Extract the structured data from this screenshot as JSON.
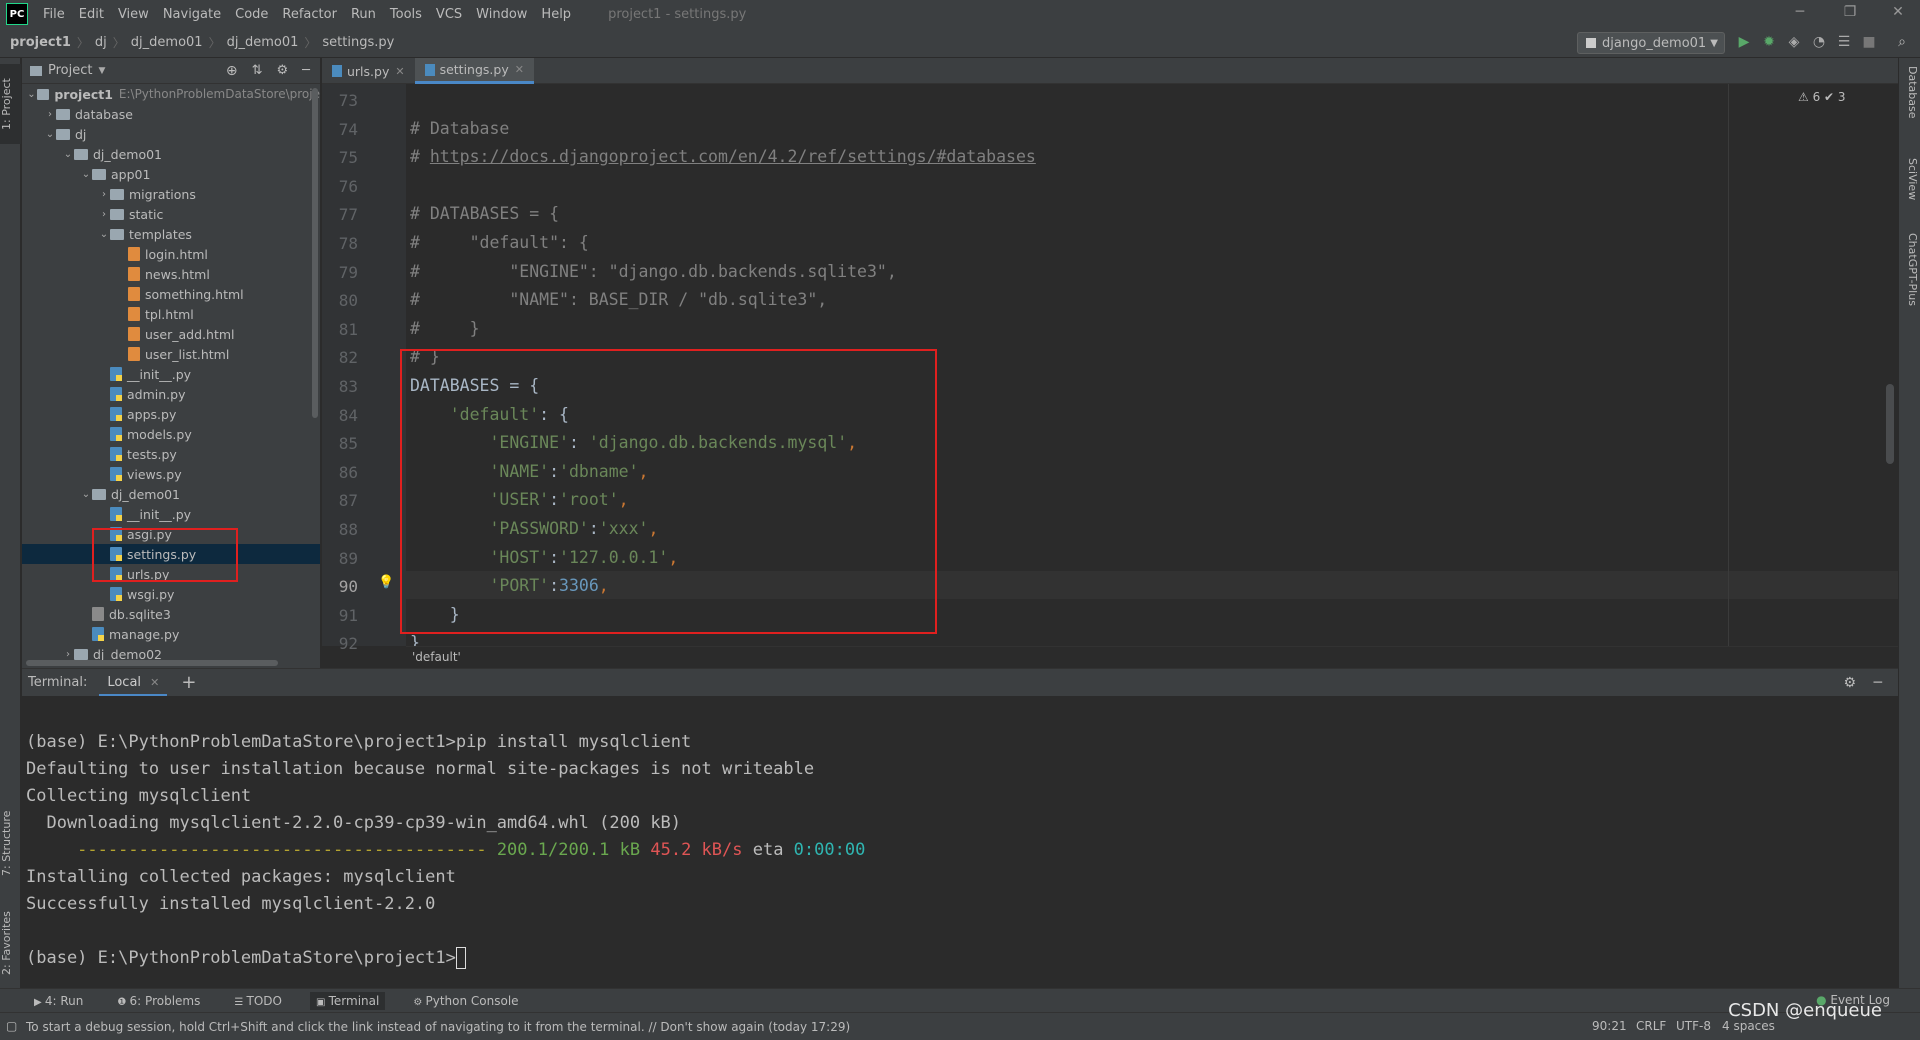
{
  "app": {
    "logo": "PC",
    "window_title": "project1 - settings.py",
    "menu": [
      "File",
      "Edit",
      "View",
      "Navigate",
      "Code",
      "Refactor",
      "Run",
      "Tools",
      "VCS",
      "Window",
      "Help"
    ]
  },
  "breadcrumbs": [
    "project1",
    "dj",
    "dj_demo01",
    "dj_demo01",
    "settings.py"
  ],
  "run_config": "django_demo01",
  "left_strip": {
    "project_tab": "1: Project",
    "structure_tab": "7: Structure",
    "favorites_tab": "2: Favorites"
  },
  "right_strip": [
    "Database",
    "SciView",
    "ChatGPT-Plus"
  ],
  "project_panel": {
    "title": "Project",
    "tree": [
      {
        "label": "project1",
        "path": "E:\\PythonProblemDataStore\\proje",
        "kind": "folder",
        "depth": 0,
        "open": true,
        "bold": true
      },
      {
        "label": "database",
        "kind": "folder",
        "depth": 1,
        "open": false
      },
      {
        "label": "dj",
        "kind": "folder",
        "depth": 1,
        "open": true
      },
      {
        "label": "dj_demo01",
        "kind": "folder",
        "depth": 2,
        "open": true
      },
      {
        "label": "app01",
        "kind": "folder",
        "depth": 3,
        "open": true
      },
      {
        "label": "migrations",
        "kind": "folder",
        "depth": 4,
        "open": false
      },
      {
        "label": "static",
        "kind": "folder",
        "depth": 4,
        "open": false
      },
      {
        "label": "templates",
        "kind": "folder",
        "depth": 4,
        "open": true
      },
      {
        "label": "login.html",
        "kind": "html",
        "depth": 5
      },
      {
        "label": "news.html",
        "kind": "html",
        "depth": 5
      },
      {
        "label": "something.html",
        "kind": "html",
        "depth": 5
      },
      {
        "label": "tpl.html",
        "kind": "html",
        "depth": 5
      },
      {
        "label": "user_add.html",
        "kind": "html",
        "depth": 5
      },
      {
        "label": "user_list.html",
        "kind": "html",
        "depth": 5
      },
      {
        "label": "__init__.py",
        "kind": "py",
        "depth": 4
      },
      {
        "label": "admin.py",
        "kind": "py",
        "depth": 4
      },
      {
        "label": "apps.py",
        "kind": "py",
        "depth": 4
      },
      {
        "label": "models.py",
        "kind": "py",
        "depth": 4
      },
      {
        "label": "tests.py",
        "kind": "py",
        "depth": 4
      },
      {
        "label": "views.py",
        "kind": "py",
        "depth": 4
      },
      {
        "label": "dj_demo01",
        "kind": "folder",
        "depth": 3,
        "open": true
      },
      {
        "label": "__init__.py",
        "kind": "py",
        "depth": 4
      },
      {
        "label": "asgi.py",
        "kind": "py",
        "depth": 4
      },
      {
        "label": "settings.py",
        "kind": "py",
        "depth": 4,
        "selected": true
      },
      {
        "label": "urls.py",
        "kind": "py",
        "depth": 4
      },
      {
        "label": "wsgi.py",
        "kind": "py",
        "depth": 4
      },
      {
        "label": "db.sqlite3",
        "kind": "db",
        "depth": 3
      },
      {
        "label": "manage.py",
        "kind": "py",
        "depth": 3
      },
      {
        "label": "dj_demo02",
        "kind": "folder",
        "depth": 2,
        "open": false
      }
    ]
  },
  "editor": {
    "tabs": [
      {
        "label": "urls.py",
        "active": false
      },
      {
        "label": "settings.py",
        "active": true
      }
    ],
    "inspections": "⚠ 6  ✔ 3",
    "current_line": 90,
    "lines": [
      {
        "no": "73",
        "segs": []
      },
      {
        "no": "74",
        "segs": [
          {
            "t": "# Database",
            "c": "c-comment"
          }
        ]
      },
      {
        "no": "75",
        "segs": [
          {
            "t": "# ",
            "c": "c-comment"
          },
          {
            "t": "https://docs.djangoproject.com/en/4.2/ref/settings/#databases",
            "c": "c-url"
          }
        ]
      },
      {
        "no": "76",
        "segs": []
      },
      {
        "no": "77",
        "segs": [
          {
            "t": "# DATABASES = {",
            "c": "c-comment"
          }
        ]
      },
      {
        "no": "78",
        "segs": [
          {
            "t": "#     \"default\": {",
            "c": "c-comment"
          }
        ]
      },
      {
        "no": "79",
        "segs": [
          {
            "t": "#         \"ENGINE\": \"django.db.backends.sqlite3\",",
            "c": "c-comment"
          }
        ]
      },
      {
        "no": "80",
        "segs": [
          {
            "t": "#         \"NAME\": BASE_DIR / \"db.sqlite3\",",
            "c": "c-comment"
          }
        ]
      },
      {
        "no": "81",
        "segs": [
          {
            "t": "#     }",
            "c": "c-comment"
          }
        ]
      },
      {
        "no": "82",
        "segs": [
          {
            "t": "# }",
            "c": "c-comment"
          }
        ]
      },
      {
        "no": "83",
        "segs": [
          {
            "t": "DATABASES = {",
            "c": ""
          }
        ]
      },
      {
        "no": "84",
        "segs": [
          {
            "t": "    ",
            "c": ""
          },
          {
            "t": "'default'",
            "c": "c-str"
          },
          {
            "t": ": {",
            "c": ""
          }
        ]
      },
      {
        "no": "85",
        "segs": [
          {
            "t": "        ",
            "c": ""
          },
          {
            "t": "'ENGINE'",
            "c": "c-str"
          },
          {
            "t": ": ",
            "c": ""
          },
          {
            "t": "'django.db.backends.mysql'",
            "c": "c-str"
          },
          {
            "t": ",",
            "c": "c-kw"
          }
        ]
      },
      {
        "no": "86",
        "segs": [
          {
            "t": "        ",
            "c": ""
          },
          {
            "t": "'NAME'",
            "c": "c-str"
          },
          {
            "t": ":",
            "c": ""
          },
          {
            "t": "'dbname'",
            "c": "c-str"
          },
          {
            "t": ",",
            "c": "c-kw"
          }
        ]
      },
      {
        "no": "87",
        "segs": [
          {
            "t": "        ",
            "c": ""
          },
          {
            "t": "'USER'",
            "c": "c-str"
          },
          {
            "t": ":",
            "c": ""
          },
          {
            "t": "'root'",
            "c": "c-str"
          },
          {
            "t": ",",
            "c": "c-kw"
          }
        ]
      },
      {
        "no": "88",
        "segs": [
          {
            "t": "        ",
            "c": ""
          },
          {
            "t": "'PASSWORD'",
            "c": "c-str"
          },
          {
            "t": ":",
            "c": ""
          },
          {
            "t": "'xxx'",
            "c": "c-str"
          },
          {
            "t": ",",
            "c": "c-kw"
          }
        ]
      },
      {
        "no": "89",
        "segs": [
          {
            "t": "        ",
            "c": ""
          },
          {
            "t": "'HOST'",
            "c": "c-str"
          },
          {
            "t": ":",
            "c": ""
          },
          {
            "t": "'127.0.0.1'",
            "c": "c-str"
          },
          {
            "t": ",",
            "c": "c-kw"
          }
        ]
      },
      {
        "no": "90",
        "segs": [
          {
            "t": "        ",
            "c": ""
          },
          {
            "t": "'PORT'",
            "c": "c-str"
          },
          {
            "t": ":",
            "c": ""
          },
          {
            "t": "3306",
            "c": "c-num"
          },
          {
            "t": ",",
            "c": "c-kw"
          }
        ]
      },
      {
        "no": "91",
        "segs": [
          {
            "t": "    }",
            "c": ""
          }
        ]
      },
      {
        "no": "92",
        "segs": [
          {
            "t": "}",
            "c": ""
          }
        ]
      }
    ],
    "breadcrumb": "'default'"
  },
  "terminal": {
    "label": "Terminal:",
    "tab": "Local",
    "lines": [
      {
        "segs": []
      },
      {
        "segs": [
          {
            "t": "(base) E:\\PythonProblemDataStore\\project1>pip install mysqlclient",
            "c": ""
          }
        ]
      },
      {
        "segs": [
          {
            "t": "Defaulting to user installation because normal site-packages is not writeable",
            "c": ""
          }
        ]
      },
      {
        "segs": [
          {
            "t": "Collecting mysqlclient",
            "c": ""
          }
        ]
      },
      {
        "segs": [
          {
            "t": "  Downloading mysqlclient-2.2.0-cp39-cp39-win_amd64.whl (200 kB)",
            "c": ""
          }
        ]
      },
      {
        "segs": [
          {
            "t": "     ---------------------------------------- ",
            "c": "t-dash"
          },
          {
            "t": "200.1/200.1 kB",
            "c": "t-green"
          },
          {
            "t": " ",
            "c": ""
          },
          {
            "t": "45.2 kB/s",
            "c": "t-red"
          },
          {
            "t": " eta ",
            "c": ""
          },
          {
            "t": "0:00:00",
            "c": "t-cyan"
          }
        ]
      },
      {
        "segs": [
          {
            "t": "Installing collected packages: mysqlclient",
            "c": ""
          }
        ]
      },
      {
        "segs": [
          {
            "t": "Successfully installed mysqlclient-2.2.0",
            "c": ""
          }
        ]
      },
      {
        "segs": []
      },
      {
        "segs": [
          {
            "t": "(base) E:\\PythonProblemDataStore\\project1>",
            "c": ""
          }
        ],
        "cursor": true
      }
    ]
  },
  "tool_tabs": [
    {
      "label": "4: Run",
      "icon": "play-icon",
      "active": false
    },
    {
      "label": "6: Problems",
      "icon": "info-icon",
      "active": false
    },
    {
      "label": "TODO",
      "icon": "list-icon",
      "active": false
    },
    {
      "label": "Terminal",
      "icon": "terminal-icon",
      "active": true
    },
    {
      "label": "Python Console",
      "icon": "python-icon",
      "active": false
    }
  ],
  "event_log": "Event Log",
  "status": {
    "message": "To start a debug session, hold Ctrl+Shift and click the link instead of navigating to it from the terminal. // Don't show again (today 17:29)",
    "position": "90:21",
    "line_sep": "CRLF",
    "encoding": "UTF-8",
    "indent": "4 spaces",
    "watermark": "CSDN @enqueue"
  },
  "colors": {
    "accent": "#4a88c7",
    "highlight_box": "#e0201f",
    "selection": "#0d293e"
  }
}
